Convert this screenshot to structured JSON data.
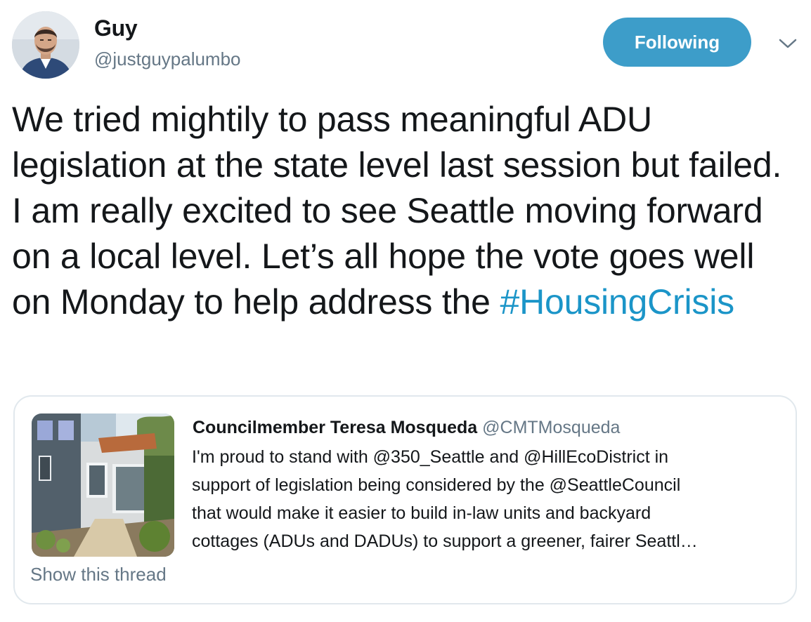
{
  "author": {
    "display_name": "Guy",
    "handle": "@justguypalumbo",
    "avatar_icon": "avatar-photo"
  },
  "follow_button": {
    "label": "Following",
    "color": "#3d9dc9"
  },
  "menu_icon": "chevron-down-icon",
  "tweet": {
    "text_before": "We tried mightily to pass meaningful ADU legislation at the state level last session but failed. I am really excited to see Seattle moving forward on a local level. Let’s all hope the vote goes well on Monday to help address the ",
    "hashtag": "#HousingCrisis",
    "hashtag_color": "#1b95c8"
  },
  "quoted_tweet": {
    "display_name": "Councilmember Teresa Mosqueda",
    "handle": "@CMTMosqueda",
    "lines": [
      "I'm proud to stand with @350_Seattle and @HillEcoDistrict in",
      "support of legislation being considered by the @SeattleCouncil",
      "that would make it easier to build in-law units and backyard",
      "cottages (ADUs and DADUs) to support a greener, fairer Seattl…"
    ],
    "thumbnail_icon": "house-photo"
  },
  "show_thread_label": "Show this thread"
}
